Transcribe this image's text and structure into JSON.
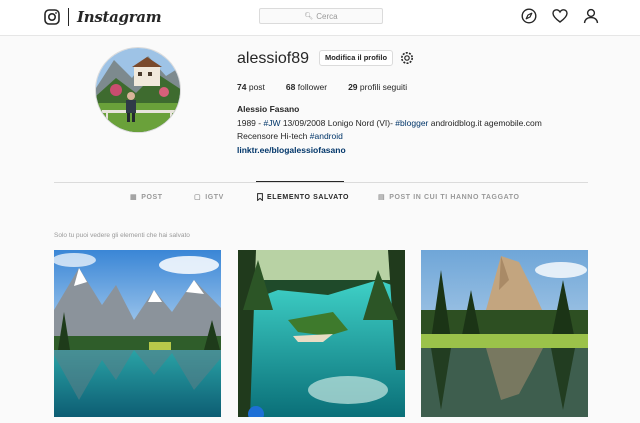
{
  "header": {
    "brand": "Instagram",
    "search_placeholder": "Cerca",
    "icons": [
      "instagram-camera-icon",
      "search-icon",
      "explore-compass-icon",
      "heart-icon",
      "profile-icon"
    ]
  },
  "profile": {
    "username": "alessiof89",
    "edit_button": "Modifica il profilo",
    "stats": [
      {
        "value": "74",
        "label": "post"
      },
      {
        "value": "68",
        "label": "follower"
      },
      {
        "value": "29",
        "label": "profili seguiti"
      }
    ],
    "full_name": "Alessio Fasano",
    "bio_line1": {
      "pre": "1989 - ",
      "tag1": "#JW",
      "mid": " 13/09/2008 Lonigo Nord (VI)- ",
      "tag2": "#blogger",
      "post": " androidblog.it agemobile.com"
    },
    "bio_line2": {
      "pre": "Recensore Hi-tech ",
      "tag": "#android"
    },
    "link": "linktr.ee/blogalessiofasano"
  },
  "tabs": [
    {
      "label": "POST",
      "icon": "grid-icon",
      "active": false
    },
    {
      "label": "IGTV",
      "icon": "igtv-icon",
      "active": false
    },
    {
      "label": "ELEMENTO SALVATO",
      "icon": "bookmark-icon",
      "active": true
    },
    {
      "label": "POST IN CUI TI HANNO TAGGATO",
      "icon": "tagged-icon",
      "active": false
    }
  ],
  "saved_note": "Solo tu puoi vedere gli elementi che hai salvato",
  "colors": {
    "background": "#fafafa",
    "link": "#003569",
    "text": "#262626",
    "muted": "#999999",
    "border": "#dbdbdb"
  }
}
